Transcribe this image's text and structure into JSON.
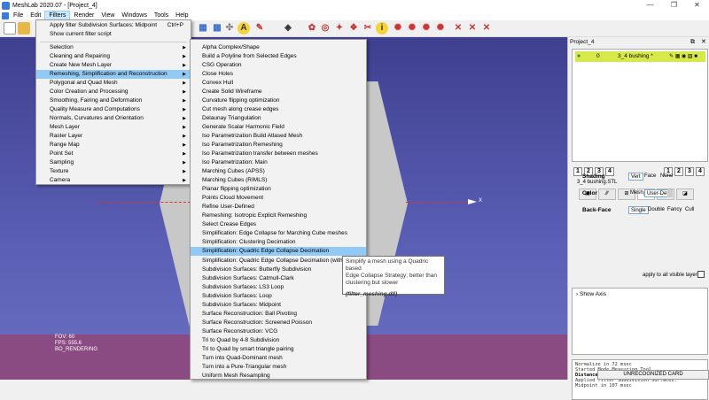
{
  "window": {
    "title": "MeshLab 2020.07 - [Project_4]",
    "min": "—",
    "max": "❐",
    "close": "✕"
  },
  "menubar": [
    "File",
    "Edit",
    "Filters",
    "Render",
    "View",
    "Windows",
    "Tools",
    "Help"
  ],
  "filters_menu": {
    "items": [
      {
        "label": "Apply filter Subdivision Surfaces: Midpoint",
        "shortcut": "Ctrl+P",
        "sub": false
      },
      {
        "label": "Show current filter script",
        "shortcut": "",
        "sub": false
      },
      {
        "label": "Selection",
        "sub": true
      },
      {
        "label": "Cleaning and Repairing",
        "sub": true
      },
      {
        "label": "Create New Mesh Layer",
        "sub": true
      },
      {
        "label": "Remeshing, Simplification and Reconstruction",
        "sub": true,
        "highlight": true
      },
      {
        "label": "Polygonal and Quad Mesh",
        "sub": true
      },
      {
        "label": "Color Creation and Processing",
        "sub": true
      },
      {
        "label": "Smoothing, Fairing and Deformation",
        "sub": true
      },
      {
        "label": "Quality Measure and Computations",
        "sub": true
      },
      {
        "label": "Normals, Curvatures and Orientation",
        "sub": true
      },
      {
        "label": "Mesh Layer",
        "sub": true
      },
      {
        "label": "Raster Layer",
        "sub": true
      },
      {
        "label": "Range Map",
        "sub": true
      },
      {
        "label": "Point Set",
        "sub": true
      },
      {
        "label": "Sampling",
        "sub": true
      },
      {
        "label": "Texture",
        "sub": true
      },
      {
        "label": "Camera",
        "sub": true
      }
    ]
  },
  "submenu": {
    "items": [
      "Alpha Complex/Shape",
      "Build a Polyline from Selected Edges",
      "CSG Operation",
      "Close Holes",
      "Convex Hull",
      "Create Solid Wireframe",
      "Curvature flipping optimization",
      "Cut mesh along crease edges",
      "Delaunay Triangulation",
      "Generate Scalar Harmonic Field",
      "Iso Parametrization Build Atlased Mesh",
      "Iso Parametrization Remeshing",
      "Iso Parametrization transfer between meshes",
      "Iso Parametrization: Main",
      "Marching Cubes (APSS)",
      "Marching Cubes (RIMLS)",
      "Planar flipping optimization",
      "Points Cloud Movement",
      "Refine User-Defined",
      "Remeshing: Isotropic Explicit Remeshing",
      "Select Crease Edges",
      "Simplification: Edge Collapse for Marching Cube meshes",
      "Simplification: Clustering Decimation",
      "Simplification: Quadric Edge Collapse Decimation",
      "Simplification: Quadric Edge Collapse Decimation (with te",
      "Subdivision Surfaces: Butterfly Subdivision",
      "Subdivision Surfaces: Catmull-Clark",
      "Subdivision Surfaces: LS3 Loop",
      "Subdivision Surfaces: Loop",
      "Subdivision Surfaces: Midpoint",
      "Surface Reconstruction: Ball Pivoting",
      "Surface Reconstruction: Screened Poisson",
      "Surface Reconstruction: VCG",
      "Tri to Quad by 4-8 Subdivision",
      "Tri to Quad by smart triangle pairing",
      "Turn into Quad-Dominant mesh",
      "Turn into a Pure-Triangular mesh",
      "Uniform Mesh Resampling"
    ],
    "highlight_index": 23
  },
  "tooltip": {
    "lines": [
      "Simplify a mesh using a Quadric based",
      "Edge Collapse Strategy; better than",
      "clustering but slower"
    ],
    "file": "(filter_meshing.dll)"
  },
  "viewport": {
    "stats": [
      "FOV: 60",
      "FPS:  555.6",
      "BO_RENDERING"
    ],
    "axis_label": "X"
  },
  "panel": {
    "title": "Project_4",
    "layer": {
      "index": "0",
      "name": "3_4 bushing *"
    },
    "num_buttons": [
      "1",
      "2",
      "3",
      "4"
    ],
    "mesh_name": "3_4 bushing.STL",
    "tabs": [
      "▣",
      "⁄⁄⁄",
      "⊞",
      "◧",
      "▲",
      "◪"
    ],
    "shading": {
      "label": "Shading",
      "options": [
        "Vert",
        "Face",
        "None"
      ]
    },
    "color": {
      "label": "Color",
      "options": [
        "Mesh",
        "User-Def"
      ]
    },
    "backface": {
      "label": "Back-Face",
      "options": [
        "Single",
        "Double",
        "Fancy",
        "Cull"
      ]
    },
    "apply_label": "apply to all visible layers",
    "show_axis": "Show Axis",
    "log": [
      "Normalize in 72 msec",
      "Started Mode Measuring Tool",
      "Distance M0: 0.034315",
      "Applied filter Subdivision Surfaces:",
      "Midpoint in 107 msec"
    ]
  },
  "status": {
    "card": "UNRECOGNIZED CARD"
  },
  "colors": {
    "accent": "#91c9f7",
    "layer_row": "#d7e84a",
    "viewport_top": "#3f3f8f",
    "ground": "#8a4a82"
  }
}
